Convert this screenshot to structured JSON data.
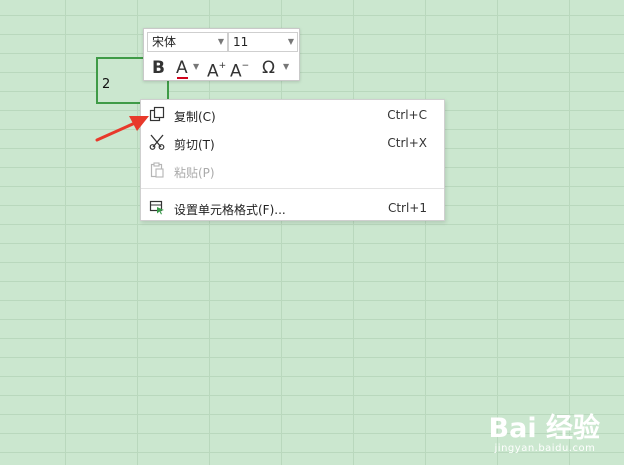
{
  "cell": {
    "value": "2"
  },
  "toolbar": {
    "font_name": "宋体",
    "font_size": "11",
    "bold_label": "B",
    "font_color_label": "A",
    "grow_label": "A",
    "shrink_label": "A",
    "symbol_label": "Ω",
    "accent_color": "#d0021b"
  },
  "context_menu": {
    "items": [
      {
        "label": "复制(C)",
        "shortcut": "Ctrl+C",
        "icon": "copy-icon",
        "enabled": true
      },
      {
        "label": "剪切(T)",
        "shortcut": "Ctrl+X",
        "icon": "scissors-icon",
        "enabled": true
      },
      {
        "label": "粘贴(P)",
        "shortcut": "",
        "icon": "paste-icon",
        "enabled": false
      },
      {
        "label": "设置单元格格式(F)...",
        "shortcut": "Ctrl+1",
        "icon": "format-cells-icon",
        "enabled": true
      }
    ]
  },
  "annotation": {
    "arrow_color": "#e8392b"
  },
  "watermark": {
    "brand": "Bai 经验",
    "url": "jingyan.baidu.com"
  }
}
